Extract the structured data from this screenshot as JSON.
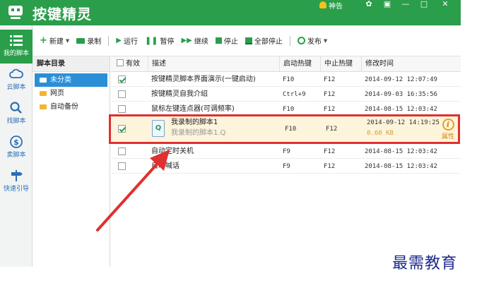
{
  "window": {
    "title": "按键精灵",
    "announcement": "神告",
    "colors": {
      "titlebar": "#2a9e4a",
      "highlight": "#e0302f",
      "selected_folder": "#2a8fd6"
    }
  },
  "leftnav": {
    "items": [
      {
        "label": "我的脚本",
        "icon": "list-icon",
        "active": true
      },
      {
        "label": "云脚本",
        "icon": "cloud-icon"
      },
      {
        "label": "找脚本",
        "icon": "search-icon"
      },
      {
        "label": "卖脚本",
        "icon": "dollar-icon"
      },
      {
        "label": "快速引导",
        "icon": "signpost-icon"
      }
    ]
  },
  "toolbar": {
    "new": "新建",
    "record": "录制",
    "run": "运行",
    "pause": "暂停",
    "resume": "继续",
    "stop": "停止",
    "stop_all": "全部停止",
    "publish": "发布"
  },
  "directory": {
    "header": "脚本目录",
    "items": [
      "未分类",
      "网页",
      "自动备份"
    ]
  },
  "table": {
    "columns": [
      "有效",
      "描述",
      "启动热键",
      "中止热键",
      "修改时间"
    ],
    "rows": [
      {
        "checked": true,
        "desc": "按键精灵脚本界面演示(一键启动)",
        "start": "F10",
        "stop": "F12",
        "time": "2014-09-12 12:07:49"
      },
      {
        "checked": false,
        "desc": "按键精灵自我介绍",
        "start": "Ctrl+9",
        "stop": "F12",
        "time": "2014-09-03 16:35:56"
      },
      {
        "checked": false,
        "desc": "鼠标左键连点器(可调频率)",
        "start": "F10",
        "stop": "F12",
        "time": "2014-08-15 12:03:42"
      },
      {
        "checked": true,
        "desc": "我录制的脚本1",
        "subdesc": "我录制的脚本1.Q",
        "start": "F10",
        "stop": "F12",
        "time": "2014-09-12 14:19:25",
        "size": "0.60 KB",
        "property": "属性"
      },
      {
        "checked": false,
        "desc": "自动定时关机",
        "start": "F9",
        "stop": "F12",
        "time": "2014-08-15 12:03:42"
      },
      {
        "checked": false,
        "desc": "自动喊话",
        "start": "F9",
        "stop": "F12",
        "time": "2014-08-15 12:03:42"
      }
    ]
  },
  "watermark": "最需教育"
}
